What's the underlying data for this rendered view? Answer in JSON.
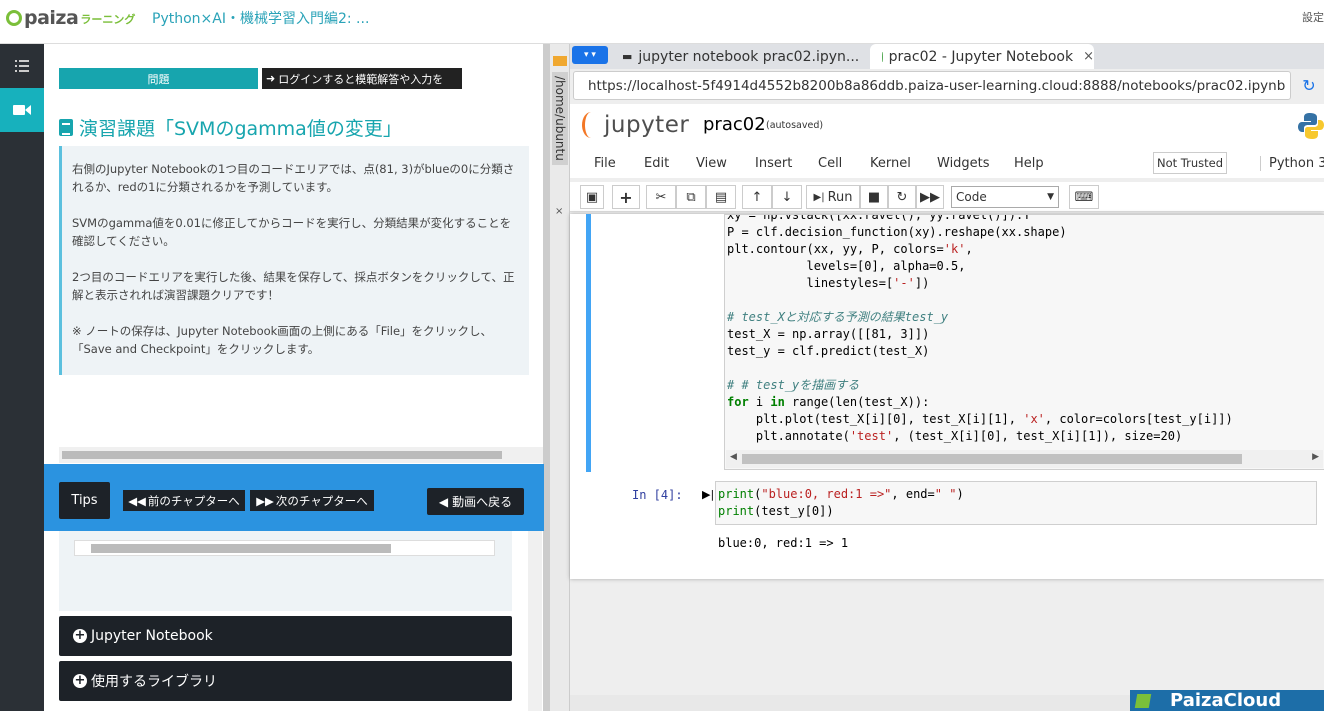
{
  "topbar": {
    "logo_text": "paiza",
    "logo_kana": "ラーニング",
    "course_title": "Python×AI・機械学習入門編2: ...",
    "settings_label": "設定"
  },
  "left": {
    "tab_problem": "問題",
    "tab_login": "ログインすると模範解答や入力を",
    "exercise_title": "演習課題「SVMのgamma値の変更」",
    "description": [
      "右側のJupyter Notebookの1つ目のコードエリアでは、点(81, 3)がblueの0に分類されるか、redの1に分類されるかを予測しています。",
      "SVMのgamma値を0.01に修正してからコードを実行し、分類結果が変化することを確認してください。",
      "2つ目のコードエリアを実行した後、結果を保存して、採点ボタンをクリックして、正解と表示されれば演習課題クリアです！",
      "※ ノートの保存は、Jupyter Notebook画面の上側にある「File」をクリックし、「Save and Checkpoint」をクリックします。"
    ],
    "tips_label": "Tips",
    "prev_label": "前のチャプターへ",
    "next_label": "次のチャプターへ",
    "back_label": "動画へ戻る",
    "accordion": [
      "Jupyter Notebook",
      "使用するライブラリ"
    ]
  },
  "filetab": {
    "path": "/home/ubuntu",
    "close": "×"
  },
  "browser": {
    "tabs": [
      {
        "title": "jupyter notebook prac02.ipyn...",
        "close": "×"
      },
      {
        "title": "prac02 - Jupyter Notebook",
        "close": "×"
      }
    ],
    "url": "https://localhost-5f4914d4552b8200b8a86ddb.paiza-user-learning.cloud:8888/notebooks/prac02.ipynb"
  },
  "jupyter": {
    "logo_word": "jupyter",
    "notebook_name": "prac02",
    "autosaved": "(autosaved)",
    "menu": [
      "File",
      "Edit",
      "View",
      "Insert",
      "Cell",
      "Kernel",
      "Widgets",
      "Help"
    ],
    "trust": "Not Trusted",
    "kernel": "Python 3",
    "run_label": "Run",
    "cell_type": "Code",
    "cell2_prompt": "In [4]:",
    "output": "blue:0, red:1 => 1"
  },
  "brand": {
    "paizacloud": "PaizaCloud"
  },
  "colors": {
    "teal": "#17a5ae",
    "blue_bar": "#2b93e0",
    "dark": "#1d2228",
    "jupyter_orange": "#f37726",
    "cell_selected": "#42a5f5"
  }
}
